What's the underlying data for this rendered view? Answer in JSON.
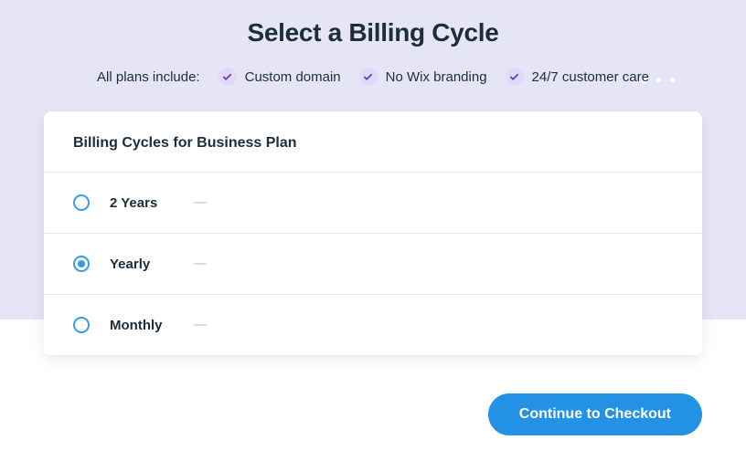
{
  "header": {
    "title": "Select a Billing Cycle",
    "includes_label": "All plans include:",
    "includes": [
      {
        "label": "Custom domain"
      },
      {
        "label": "No Wix branding"
      },
      {
        "label": "24/7 customer care"
      }
    ]
  },
  "card": {
    "title": "Billing Cycles for Business Plan",
    "options": [
      {
        "label": "2 Years",
        "selected": false
      },
      {
        "label": "Yearly",
        "selected": true
      },
      {
        "label": "Monthly",
        "selected": false
      }
    ]
  },
  "cta": {
    "label": "Continue to Checkout"
  }
}
